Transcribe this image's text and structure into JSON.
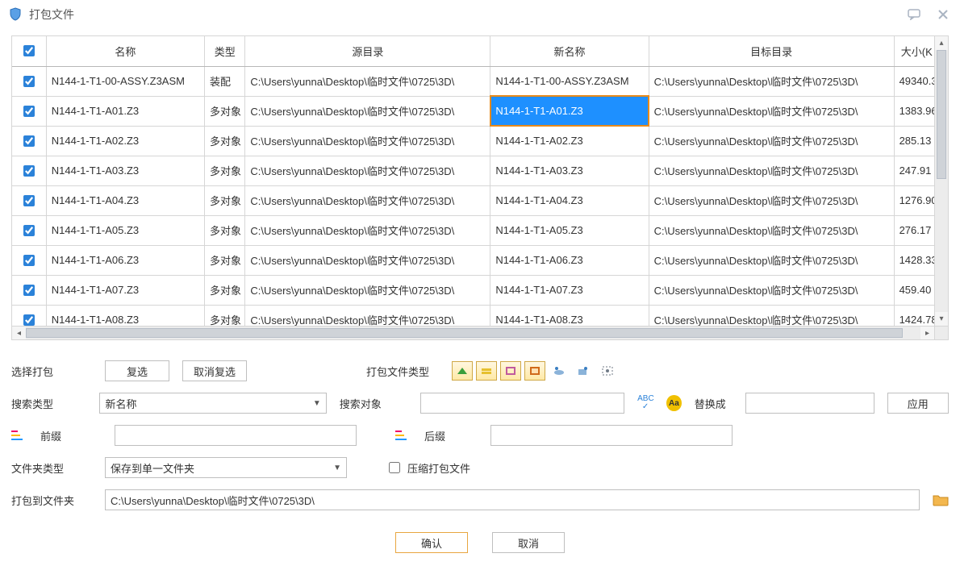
{
  "window": {
    "title": "打包文件"
  },
  "table": {
    "headers": {
      "name": "名称",
      "type": "类型",
      "srcdir": "源目录",
      "newname": "新名称",
      "dstdir": "目标目录",
      "size": "大小(K"
    },
    "srcdir_value": "C:\\Users\\yunna\\Desktop\\临时文件\\0725\\3D\\",
    "dstdir_value": "C:\\Users\\yunna\\Desktop\\临时文件\\0725\\3D\\",
    "rows": [
      {
        "name": "N144-1-T1-00-ASSY.Z3ASM",
        "type": "装配",
        "newname": "N144-1-T1-00-ASSY.Z3ASM",
        "size": "49340.3",
        "sel": false
      },
      {
        "name": "N144-1-T1-A01.Z3",
        "type": "多对象",
        "newname": "N144-1-T1-A01.Z3",
        "size": "1383.96",
        "sel": true
      },
      {
        "name": "N144-1-T1-A02.Z3",
        "type": "多对象",
        "newname": "N144-1-T1-A02.Z3",
        "size": "285.13",
        "sel": false
      },
      {
        "name": "N144-1-T1-A03.Z3",
        "type": "多对象",
        "newname": "N144-1-T1-A03.Z3",
        "size": "247.91",
        "sel": false
      },
      {
        "name": "N144-1-T1-A04.Z3",
        "type": "多对象",
        "newname": "N144-1-T1-A04.Z3",
        "size": "1276.90",
        "sel": false
      },
      {
        "name": "N144-1-T1-A05.Z3",
        "type": "多对象",
        "newname": "N144-1-T1-A05.Z3",
        "size": "276.17",
        "sel": false
      },
      {
        "name": "N144-1-T1-A06.Z3",
        "type": "多对象",
        "newname": "N144-1-T1-A06.Z3",
        "size": "1428.33",
        "sel": false
      },
      {
        "name": "N144-1-T1-A07.Z3",
        "type": "多对象",
        "newname": "N144-1-T1-A07.Z3",
        "size": "459.40",
        "sel": false
      },
      {
        "name": "N144-1-T1-A08.Z3",
        "type": "多对象",
        "newname": "N144-1-T1-A08.Z3",
        "size": "1424.78",
        "sel": false
      }
    ]
  },
  "form": {
    "select_pack": "选择打包",
    "reselect_btn": "复选",
    "cancel_reselect_btn": "取消复选",
    "pack_type_label": "打包文件类型",
    "search_type_label": "搜索类型",
    "search_type_value": "新名称",
    "search_obj_label": "搜索对象",
    "replace_to_label": "替换成",
    "apply_btn": "应用",
    "prefix_label": "前缀",
    "suffix_label": "后缀",
    "folder_type_label": "文件夹类型",
    "folder_type_value": "保存到单一文件夹",
    "zip_label": "压缩打包文件",
    "pack_to_label": "打包到文件夹",
    "pack_to_value": "C:\\Users\\yunna\\Desktop\\临时文件\\0725\\3D\\",
    "ok_btn": "确认",
    "cancel_btn": "取消"
  }
}
